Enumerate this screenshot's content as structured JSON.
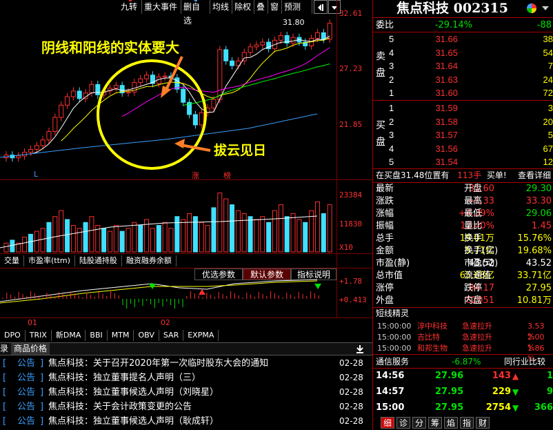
{
  "toolbar": {
    "buttons": [
      "九转",
      "重大事件",
      "删自选",
      "均线",
      "除权",
      "叠",
      "窗",
      "预测"
    ],
    "nav_icon": "back-forward-icon",
    "menu_icon": "dropdown-icon"
  },
  "stock": {
    "name": "焦点科技",
    "code": "002315",
    "ball_icon": "color-ball-icon"
  },
  "chart_data": [
    {
      "type": "candlestick",
      "price_axis_labels": [
        "32.61",
        "27.23",
        "21.85"
      ],
      "max_label": "31.80",
      "marker_labels": {
        "left": "L",
        "zhang": "涨",
        "bang": "榜"
      },
      "annotations": [
        "阴线和阳线的实体要大",
        "拔云见日"
      ],
      "ylim": [
        16.47,
        32.61
      ]
    },
    {
      "type": "bar",
      "name": "成交量",
      "axis_labels": [
        "23384",
        "11830",
        "X10"
      ]
    },
    {
      "type": "line",
      "axis_labels": [
        "+1.78",
        "+0.413"
      ],
      "x_ticks": [
        "01",
        "02"
      ]
    }
  ],
  "indicator_tabs_top": [
    "交量",
    "市盈率(ttm)",
    "陆股通持股",
    "融资融券余额"
  ],
  "param_tabs": [
    "优选参数",
    "默认参数",
    "指标说明"
  ],
  "indicator_tabs_bottom": [
    "DPO",
    "TRIX",
    "新DMA",
    "BBI",
    "MTM",
    "OBV",
    "SAR",
    "EXPMA"
  ],
  "news": {
    "tab_left": "录",
    "tab": "商品价格",
    "download_icon": "download-icon",
    "items": [
      {
        "cat": "公告",
        "title": "焦点科技：关于召开2020年第一次临时股东大会的通知",
        "date": "02-28"
      },
      {
        "cat": "公告",
        "title": "焦点科技：独立董事提名人声明（三）",
        "date": "02-28"
      },
      {
        "cat": "公告",
        "title": "焦点科技：独立董事候选人声明（刘晓星）",
        "date": "02-28"
      },
      {
        "cat": "公告",
        "title": "焦点科技：关于会计政策变更的公告",
        "date": "02-28"
      },
      {
        "cat": "公告",
        "title": "焦点科技：独立董事候选人声明（耿成轩）",
        "date": "02-28"
      }
    ]
  },
  "orderbook": {
    "weibi_label": "委比",
    "weibi_pct": "-29.14%",
    "weibi_diff": "-88",
    "sell_label": "卖盘",
    "buy_label": "买盘",
    "sell": [
      {
        "lv": "5",
        "price": "31.66",
        "vol": "38"
      },
      {
        "lv": "4",
        "price": "31.65",
        "vol": "54"
      },
      {
        "lv": "3",
        "price": "31.64",
        "vol": "7"
      },
      {
        "lv": "2",
        "price": "31.63",
        "vol": "24"
      },
      {
        "lv": "1",
        "price": "31.60",
        "vol": "72"
      }
    ],
    "buy": [
      {
        "lv": "1",
        "price": "31.59",
        "vol": "3"
      },
      {
        "lv": "2",
        "price": "31.58",
        "vol": "20"
      },
      {
        "lv": "3",
        "price": "31.57",
        "vol": "5"
      },
      {
        "lv": "4",
        "price": "31.56",
        "vol": "67"
      },
      {
        "lv": "5",
        "price": "31.54",
        "vol": "12"
      }
    ],
    "status": "在买盘31.48位置有",
    "status_vol": "113手",
    "status_action": "买单!",
    "status_link": "查看详细"
  },
  "quote": [
    {
      "l1": "最新",
      "v1": "31.60",
      "l2": "开盘",
      "v2": "29.30",
      "c1": "#ff3030",
      "c2": "#00e000"
    },
    {
      "l1": "涨跌",
      "v1": "+1.33",
      "l2": "最高",
      "v2": "33.30",
      "c1": "#ff3030",
      "c2": "#ff3030"
    },
    {
      "l1": "涨幅",
      "v1": "+4.39%",
      "l2": "最低",
      "v2": "29.06",
      "c1": "#ff3030",
      "c2": "#00e000"
    },
    {
      "l1": "振幅",
      "v1": "12.40%",
      "l2": "量比",
      "v2": "1.45",
      "c1": "#ff3030",
      "c2": "#ff3030"
    },
    {
      "l1": "总手",
      "v1": "19.01万",
      "l2": "换手",
      "v2": "15.76%",
      "c1": "#ffff00",
      "c2": "#ffff00"
    },
    {
      "l1": "金额",
      "v1": "5.71亿",
      "l2": "换手(实)",
      "v2": "19.68%",
      "c1": "#ffff00",
      "c2": "#ffff00"
    },
    {
      "l1": "市盈(静)",
      "v1": "43.52",
      "l2": "市盈(动)",
      "v2": "43.52",
      "c1": "#fff",
      "c2": "#fff"
    },
    {
      "l1": "总市值",
      "v1": "65.68亿",
      "l2": "流通值",
      "v2": "33.71亿",
      "c1": "#ffff00",
      "c2": "#ffff00"
    },
    {
      "l1": "涨停",
      "v1": "34.17",
      "l2": "跌停",
      "v2": "27.95",
      "c1": "#ff3030",
      "c2": "#ffff00"
    },
    {
      "l1": "外盘",
      "v1": "82051",
      "l2": "内盘",
      "v2": "10.81万",
      "c1": "#ff3030",
      "c2": "#ffff00"
    }
  ],
  "alerts": {
    "title": "短线精灵",
    "items": [
      {
        "time": "15:00:00",
        "name": "淳中科技",
        "act": "急速拉升",
        "pct": "3.53 %"
      },
      {
        "time": "15:00:00",
        "name": "吉比特",
        "act": "急速拉升",
        "pct": "2.00 %"
      },
      {
        "time": "15:00:00",
        "name": "和邦生物",
        "act": "急速拉升",
        "pct": "1.86 %"
      }
    ]
  },
  "sector": {
    "name": "通信服务",
    "pct": "-6.87%",
    "rank": "同行业比较"
  },
  "ticks": [
    {
      "time": "14:56",
      "price": "27.96",
      "vol": "143",
      "dir": "up",
      "extra": "1"
    },
    {
      "time": "14:57",
      "price": "27.95",
      "vol": "229",
      "dir": "down",
      "extra": "9"
    },
    {
      "time": "15:00",
      "price": "27.95",
      "vol": "2754",
      "dir": "down",
      "extra": "366"
    }
  ],
  "bottom_tabs": [
    "细",
    "诊",
    "分",
    "筹",
    "焰",
    "指",
    "财"
  ]
}
